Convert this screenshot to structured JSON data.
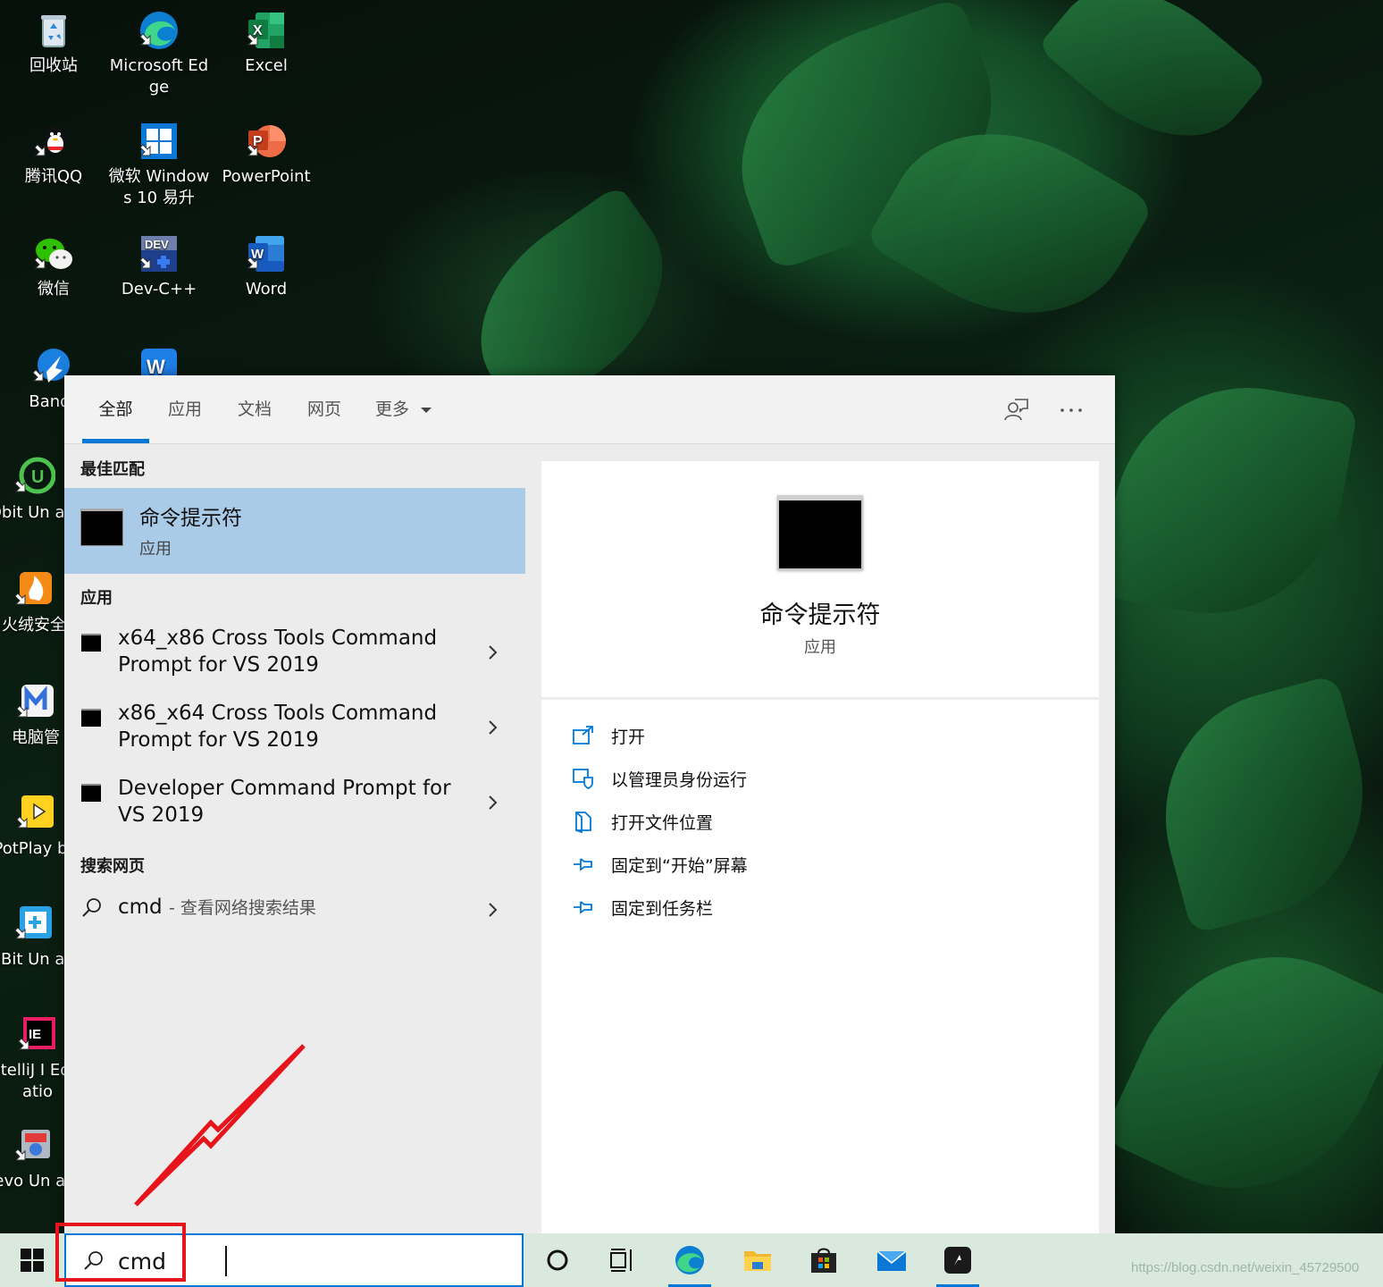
{
  "desktop": {
    "icons": [
      {
        "label": "回收站",
        "icon": "recycle-bin-icon"
      },
      {
        "label": "Microsoft Edge",
        "icon": "edge-icon"
      },
      {
        "label": "Excel",
        "icon": "excel-icon"
      },
      {
        "label": "腾讯QQ",
        "icon": "qq-icon"
      },
      {
        "label": "微软 Windows 10 易升",
        "icon": "windows-upgrade-icon"
      },
      {
        "label": "PowerPoint",
        "icon": "powerpoint-icon"
      },
      {
        "label": "微信",
        "icon": "wechat-icon"
      },
      {
        "label": "Dev-C++",
        "icon": "devcpp-icon"
      },
      {
        "label": "Word",
        "icon": "word-icon"
      },
      {
        "label": "Bandi",
        "icon": "bandizip-icon"
      },
      {
        "label": "IObit Un alle",
        "icon": "iobit-uninstaller-icon"
      },
      {
        "label": "火绒安全",
        "icon": "huorong-icon"
      },
      {
        "label": "电脑管",
        "icon": "pc-manager-icon"
      },
      {
        "label": "PotPlay bit",
        "icon": "potplayer-icon"
      },
      {
        "label": "HiBit Un alle",
        "icon": "hibit-uninstaller-icon"
      },
      {
        "label": "IntelliJ I Educatio",
        "icon": "intellij-icon"
      },
      {
        "label": "Revo Un alle",
        "icon": "revo-uninstaller-icon"
      }
    ]
  },
  "search_panel": {
    "tabs": [
      {
        "label": "全部",
        "active": true
      },
      {
        "label": "应用",
        "active": false
      },
      {
        "label": "文档",
        "active": false
      },
      {
        "label": "网页",
        "active": false
      },
      {
        "label": "更多",
        "active": false
      }
    ],
    "best_match_title": "最佳匹配",
    "best_match": {
      "name": "命令提示符",
      "type": "应用"
    },
    "apps_title": "应用",
    "apps": [
      {
        "name": "x64_x86 Cross Tools Command Prompt for VS 2019"
      },
      {
        "name": "x86_x64 Cross Tools Command Prompt for VS 2019"
      },
      {
        "name": "Developer Command Prompt for VS 2019"
      }
    ],
    "web_title": "搜索网页",
    "web_result": {
      "query": "cmd",
      "hint": "- 查看网络搜索结果"
    },
    "preview": {
      "name": "命令提示符",
      "type": "应用",
      "actions": [
        {
          "label": "打开",
          "icon": "open-icon"
        },
        {
          "label": "以管理员身份运行",
          "icon": "shield-icon"
        },
        {
          "label": "打开文件位置",
          "icon": "file-location-icon"
        },
        {
          "label": "固定到“开始”屏幕",
          "icon": "pin-icon"
        },
        {
          "label": "固定到任务栏",
          "icon": "pin-icon"
        }
      ]
    }
  },
  "taskbar": {
    "search_value": "cmd",
    "pinned": [
      "cortana-icon",
      "task-view-icon",
      "edge-icon",
      "file-explorer-icon",
      "store-icon",
      "mail-icon",
      "app-icon"
    ]
  },
  "watermark": "https://blog.csdn.net/weixin_45729500",
  "colors": {
    "accent": "#0078d7",
    "selection": "#a9cbe8",
    "annotation": "#e8141c",
    "taskbar": "#d9e9dd"
  }
}
